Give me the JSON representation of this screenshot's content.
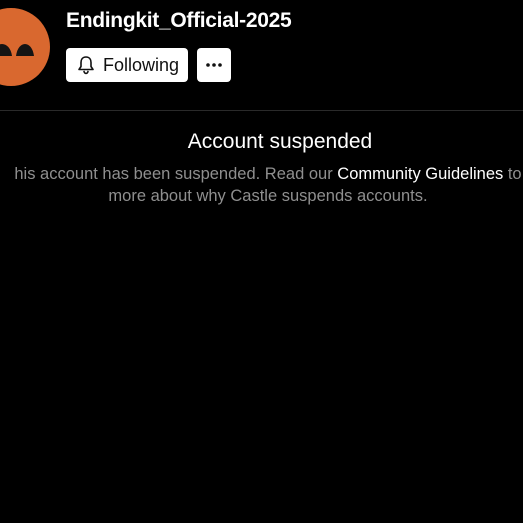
{
  "profile": {
    "username": "Endingkit_Official-2025",
    "follow_label": "Following",
    "more_label": "···",
    "avatar_color": "#d9682f"
  },
  "suspension": {
    "title": "Account suspended",
    "line1_before": "his account has been suspended. Read our ",
    "line1_link": "Community Guidelines",
    "line1_after": " to",
    "line2": "more about why Castle suspends accounts."
  },
  "icons": {
    "follow": "bell-icon",
    "more": "more-horizontal-icon"
  },
  "colors": {
    "background": "#000000",
    "text": "#ffffff",
    "muted_text": "#8f8f8f",
    "button_bg": "#ffffff"
  }
}
